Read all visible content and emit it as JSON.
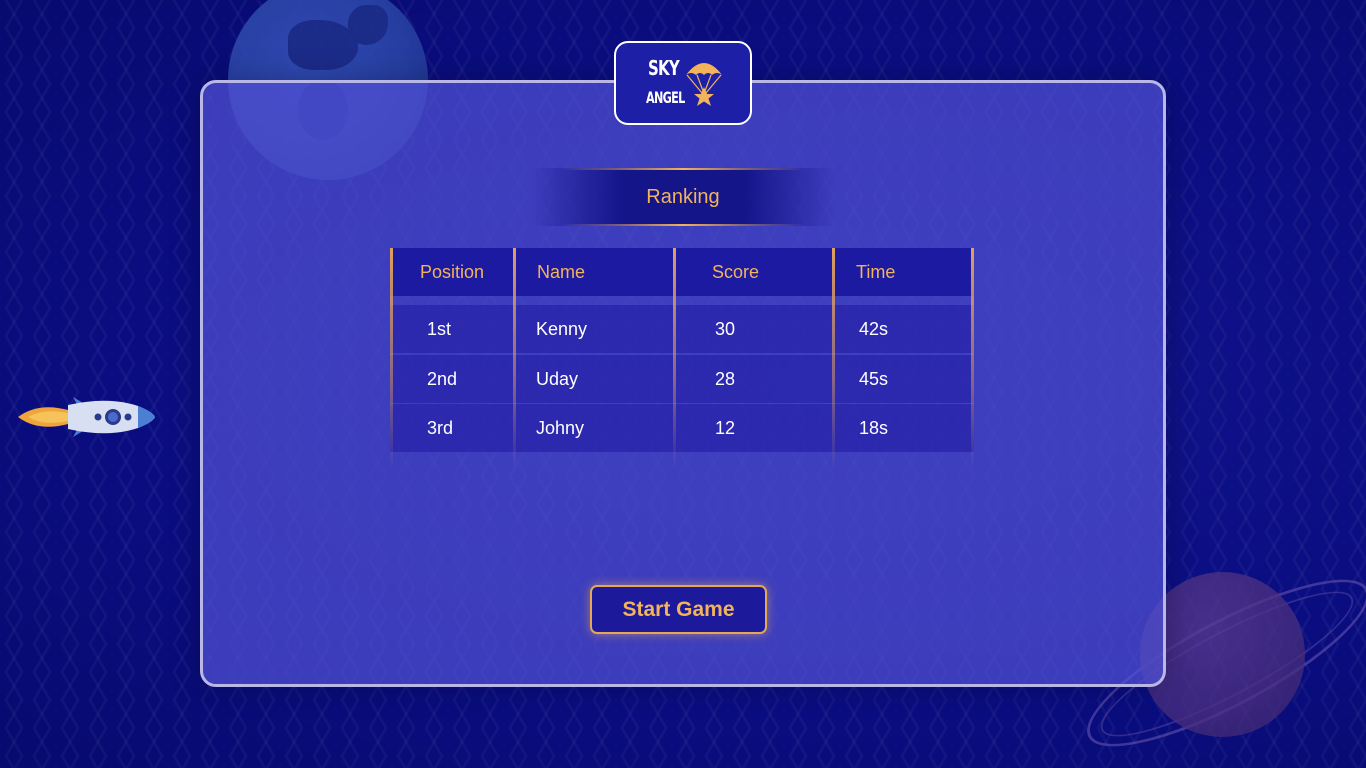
{
  "logo": {
    "line1": "SKY",
    "line2": "ANGEL",
    "icon": "parachute-star-icon"
  },
  "ranking": {
    "title": "Ranking",
    "columns": [
      "Position",
      "Name",
      "Score",
      "Time"
    ],
    "rows": [
      {
        "position": "1st",
        "name": "Kenny",
        "score": "30",
        "time": "42s"
      },
      {
        "position": "2nd",
        "name": "Uday",
        "score": "28",
        "time": "45s"
      },
      {
        "position": "3rd",
        "name": "Johny",
        "score": "12",
        "time": "18s"
      }
    ]
  },
  "actions": {
    "start_label": "Start Game"
  },
  "decorations": {
    "top_left": "earth-globe-icon",
    "left": "rocket-icon",
    "bottom_right": "ringed-planet-icon"
  },
  "colors": {
    "background": "#0b0f86",
    "panel": "#5050d2",
    "accent": "#f2b35c",
    "header": "#1c1aa0"
  }
}
